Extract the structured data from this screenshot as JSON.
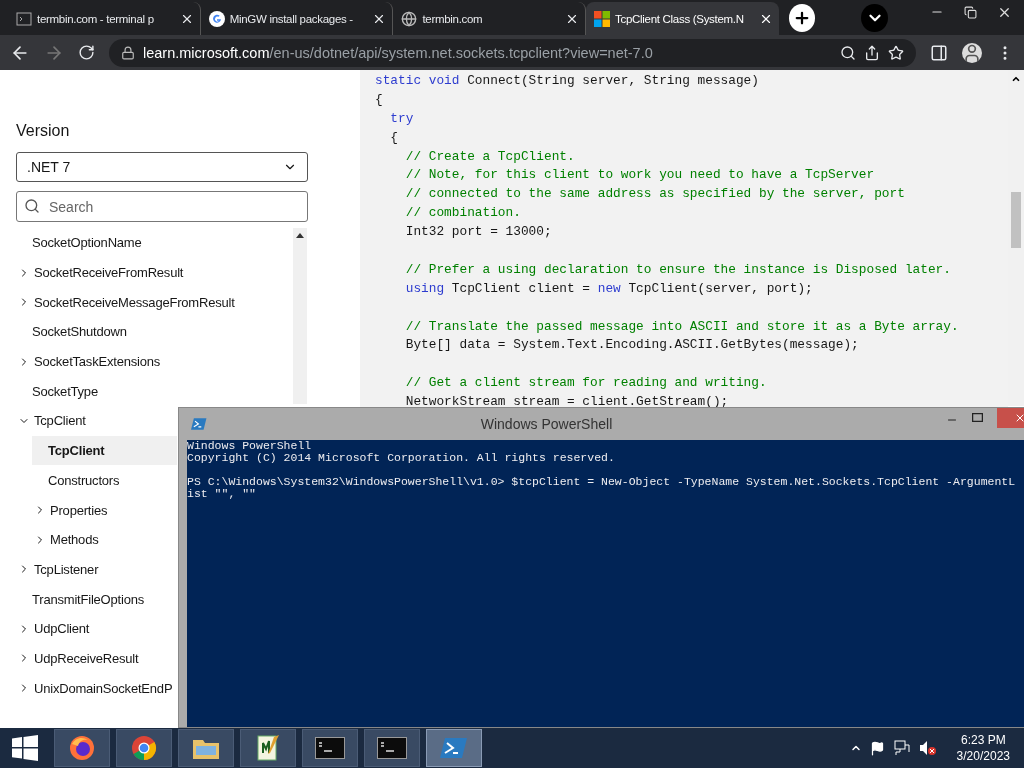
{
  "browser": {
    "tabs": [
      {
        "title": "termbin.com - terminal p",
        "kind": "terminal",
        "selected": false
      },
      {
        "title": "MinGW install packages -",
        "kind": "google",
        "selected": false
      },
      {
        "title": "termbin.com",
        "kind": "globe",
        "selected": false
      },
      {
        "title": "TcpClient Class (System.N",
        "kind": "microsoft",
        "selected": true
      }
    ],
    "url": {
      "host": "learn.microsoft.com",
      "path": "/en-us/dotnet/api/system.net.sockets.tcpclient?view=net-7.0"
    }
  },
  "sidebar": {
    "version_label": "Version",
    "version_select": ".NET 7",
    "search": {
      "placeholder": "Search"
    },
    "tree": [
      {
        "label": "SocketOptionName",
        "selected": false
      },
      {
        "label": "SocketReceiveFromResult",
        "expanded": false,
        "selected": false
      },
      {
        "label": "SocketReceiveMessageFromResult",
        "expanded": false,
        "selected": false
      },
      {
        "label": "SocketShutdown",
        "selected": false
      },
      {
        "label": "SocketTaskExtensions",
        "expanded": false,
        "selected": false
      },
      {
        "label": "SocketType",
        "selected": false
      },
      {
        "label": "TcpClient",
        "expanded": true,
        "selected": false,
        "children": [
          {
            "label": "TcpClient",
            "selected": true
          },
          {
            "label": "Constructors",
            "selected": false
          },
          {
            "label": "Properties",
            "expanded": false,
            "selected": false
          },
          {
            "label": "Methods",
            "expanded": false,
            "selected": false
          }
        ]
      },
      {
        "label": "TcpListener",
        "expanded": false,
        "selected": false
      },
      {
        "label": "TransmitFileOptions",
        "selected": false
      },
      {
        "label": "UdpClient",
        "expanded": false,
        "selected": false
      },
      {
        "label": "UdpReceiveResult",
        "expanded": false,
        "selected": false
      },
      {
        "label": "UnixDomainSocketEndP",
        "expanded": false,
        "selected": false
      }
    ]
  },
  "code": {
    "lines": [
      {
        "kind": "code",
        "segments": [
          {
            "text": "static void",
            "kind": "keyword"
          },
          {
            "text": " Connect(String server, String message)",
            "kind": "plain"
          }
        ]
      },
      {
        "kind": "code",
        "segments": [
          {
            "text": "{",
            "kind": "plain"
          }
        ]
      },
      {
        "kind": "code",
        "segments": [
          {
            "text": "  try",
            "kind": "keyword"
          }
        ]
      },
      {
        "kind": "code",
        "segments": [
          {
            "text": "  {",
            "kind": "plain"
          }
        ]
      },
      {
        "kind": "code",
        "segments": [
          {
            "text": "    // Create a TcpClient.",
            "kind": "comment"
          }
        ]
      },
      {
        "kind": "code",
        "segments": [
          {
            "text": "    // Note, for this client to work you need to have a TcpServer",
            "kind": "comment"
          }
        ]
      },
      {
        "kind": "code",
        "segments": [
          {
            "text": "    // connected to the same address as specified by the server, port",
            "kind": "comment"
          }
        ]
      },
      {
        "kind": "code",
        "segments": [
          {
            "text": "    // combination.",
            "kind": "comment"
          }
        ]
      },
      {
        "kind": "code",
        "segments": [
          {
            "text": "    Int32 port = 13000;",
            "kind": "plain"
          }
        ]
      },
      {
        "kind": "blank"
      },
      {
        "kind": "code",
        "segments": [
          {
            "text": "    // Prefer a using declaration to ensure the instance is Disposed later.",
            "kind": "comment"
          }
        ]
      },
      {
        "kind": "code",
        "segments": [
          {
            "text": "    using",
            "kind": "keyword"
          },
          {
            "text": " TcpClient client = ",
            "kind": "plain"
          },
          {
            "text": "new",
            "kind": "keyword"
          },
          {
            "text": " TcpClient(server, port);",
            "kind": "plain"
          }
        ]
      },
      {
        "kind": "blank"
      },
      {
        "kind": "code",
        "segments": [
          {
            "text": "    // Translate the passed message into ASCII and store it as a Byte array.",
            "kind": "comment"
          }
        ]
      },
      {
        "kind": "code",
        "segments": [
          {
            "text": "    Byte[] data = System.Text.Encoding.ASCII.GetBytes(message);",
            "kind": "plain"
          }
        ]
      },
      {
        "kind": "blank"
      },
      {
        "kind": "code",
        "segments": [
          {
            "text": "    // Get a client stream for reading and writing.",
            "kind": "comment"
          }
        ]
      },
      {
        "kind": "code",
        "segments": [
          {
            "text": "    NetworkStream stream = client.GetStream();",
            "kind": "plain"
          }
        ]
      }
    ]
  },
  "powershell": {
    "title": "Windows PowerShell",
    "lines": [
      {
        "kind": "text",
        "text": "Windows PowerShell"
      },
      {
        "kind": "text",
        "text": "Copyright (C) 2014 Microsoft Corporation. All rights reserved."
      },
      {
        "kind": "blank"
      },
      {
        "kind": "text",
        "text": "PS C:\\Windows\\System32\\WindowsPowerShell\\v1.0> $tcpClient = New-Object -TypeName System.Net.Sockets.TcpClient -ArgumentL"
      },
      {
        "kind": "text",
        "text": "ist \"\", \"\""
      }
    ]
  },
  "taskbar": {
    "apps": [
      {
        "kind": "firefox",
        "selected": false
      },
      {
        "kind": "chrome",
        "selected": false
      },
      {
        "kind": "explorer",
        "selected": false
      },
      {
        "kind": "notepad",
        "selected": false
      },
      {
        "kind": "cmd",
        "selected": false
      },
      {
        "kind": "cmd",
        "selected": false
      },
      {
        "kind": "powershell",
        "selected": true
      }
    ],
    "time": "6:23 PM",
    "date": "3/20/2023"
  }
}
